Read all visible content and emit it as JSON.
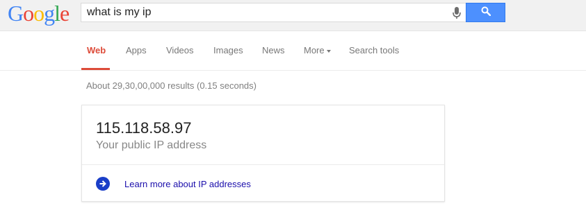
{
  "header": {
    "logo": [
      "G",
      "o",
      "o",
      "g",
      "l",
      "e"
    ],
    "logo_colors": [
      "#4285f4",
      "#ea4335",
      "#fbbc05",
      "#4285f4",
      "#34a853",
      "#ea4335"
    ],
    "search_value": "what is my ip",
    "mic_icon": "microphone-icon",
    "search_icon": "search-icon"
  },
  "tabs": {
    "items": [
      {
        "label": "Web"
      },
      {
        "label": "Apps"
      },
      {
        "label": "Videos"
      },
      {
        "label": "Images"
      },
      {
        "label": "News"
      },
      {
        "label": "More"
      },
      {
        "label": "Search tools"
      }
    ],
    "active_index": 0
  },
  "results": {
    "stats": "About 29,30,00,000 results (0.15 seconds)"
  },
  "answer_card": {
    "ip": "115.118.58.97",
    "label": "Your public IP address",
    "learn_more": "Learn more about IP addresses",
    "arrow_icon": "arrow-right-circle-icon"
  },
  "colors": {
    "accent_red": "#dd4b39",
    "search_button": "#4d90fe",
    "link": "#1a0dab",
    "arrow_circle": "#1a3ec8"
  }
}
